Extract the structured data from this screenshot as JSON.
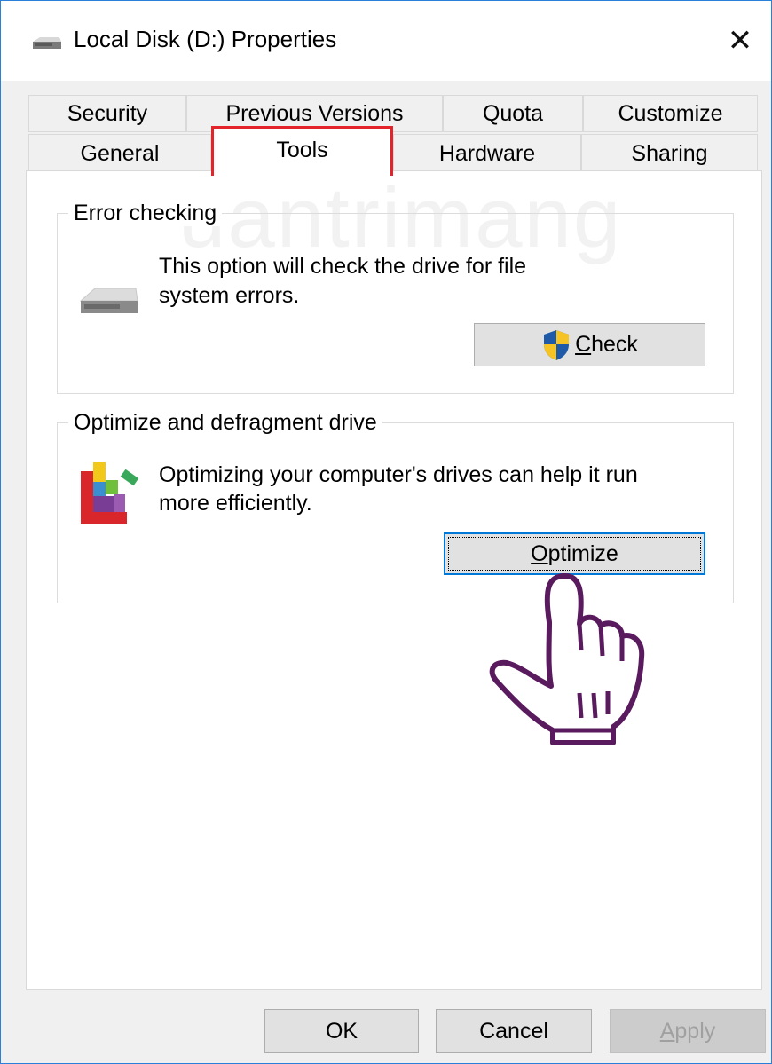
{
  "window": {
    "title": "Local Disk (D:) Properties",
    "close_glyph": "✕"
  },
  "tabs": {
    "row1": [
      {
        "label": "Security"
      },
      {
        "label": "Previous Versions"
      },
      {
        "label": "Quota"
      },
      {
        "label": "Customize"
      }
    ],
    "row2": [
      {
        "label": "General"
      },
      {
        "label": "Tools",
        "active": true
      },
      {
        "label": "Hardware"
      },
      {
        "label": "Sharing"
      }
    ]
  },
  "error_checking": {
    "title": "Error checking",
    "description_line1": "This option will check the drive for file",
    "description_line2": "system errors.",
    "button_mnemonic": "C",
    "button_rest": "heck",
    "icon": "drive-icon"
  },
  "optimize": {
    "title": "Optimize and defragment drive",
    "description_line1": "Optimizing your computer's drives can help it run",
    "description_line2": "more efficiently.",
    "button_mnemonic": "O",
    "button_rest": "ptimize",
    "icon": "defrag-icon"
  },
  "footer": {
    "ok": "OK",
    "cancel": "Cancel",
    "apply_mnemonic": "A",
    "apply_rest": "pply"
  },
  "watermark": "uantrimang",
  "colors": {
    "accent": "#0078d7",
    "highlight": "#e3242b",
    "pointer": "#5a1a5e"
  }
}
